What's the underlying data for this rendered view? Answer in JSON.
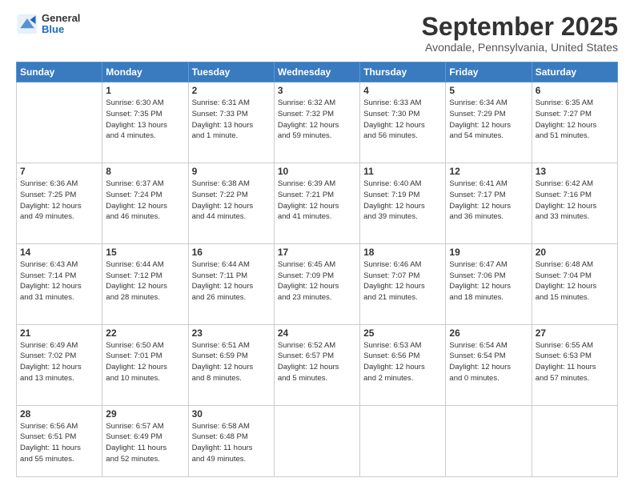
{
  "header": {
    "logo": {
      "line1": "General",
      "line2": "Blue"
    },
    "title": "September 2025",
    "location": "Avondale, Pennsylvania, United States"
  },
  "days_of_week": [
    "Sunday",
    "Monday",
    "Tuesday",
    "Wednesday",
    "Thursday",
    "Friday",
    "Saturday"
  ],
  "weeks": [
    [
      {
        "day": "",
        "info": ""
      },
      {
        "day": "1",
        "info": "Sunrise: 6:30 AM\nSunset: 7:35 PM\nDaylight: 13 hours\nand 4 minutes."
      },
      {
        "day": "2",
        "info": "Sunrise: 6:31 AM\nSunset: 7:33 PM\nDaylight: 13 hours\nand 1 minute."
      },
      {
        "day": "3",
        "info": "Sunrise: 6:32 AM\nSunset: 7:32 PM\nDaylight: 12 hours\nand 59 minutes."
      },
      {
        "day": "4",
        "info": "Sunrise: 6:33 AM\nSunset: 7:30 PM\nDaylight: 12 hours\nand 56 minutes."
      },
      {
        "day": "5",
        "info": "Sunrise: 6:34 AM\nSunset: 7:29 PM\nDaylight: 12 hours\nand 54 minutes."
      },
      {
        "day": "6",
        "info": "Sunrise: 6:35 AM\nSunset: 7:27 PM\nDaylight: 12 hours\nand 51 minutes."
      }
    ],
    [
      {
        "day": "7",
        "info": "Sunrise: 6:36 AM\nSunset: 7:25 PM\nDaylight: 12 hours\nand 49 minutes."
      },
      {
        "day": "8",
        "info": "Sunrise: 6:37 AM\nSunset: 7:24 PM\nDaylight: 12 hours\nand 46 minutes."
      },
      {
        "day": "9",
        "info": "Sunrise: 6:38 AM\nSunset: 7:22 PM\nDaylight: 12 hours\nand 44 minutes."
      },
      {
        "day": "10",
        "info": "Sunrise: 6:39 AM\nSunset: 7:21 PM\nDaylight: 12 hours\nand 41 minutes."
      },
      {
        "day": "11",
        "info": "Sunrise: 6:40 AM\nSunset: 7:19 PM\nDaylight: 12 hours\nand 39 minutes."
      },
      {
        "day": "12",
        "info": "Sunrise: 6:41 AM\nSunset: 7:17 PM\nDaylight: 12 hours\nand 36 minutes."
      },
      {
        "day": "13",
        "info": "Sunrise: 6:42 AM\nSunset: 7:16 PM\nDaylight: 12 hours\nand 33 minutes."
      }
    ],
    [
      {
        "day": "14",
        "info": "Sunrise: 6:43 AM\nSunset: 7:14 PM\nDaylight: 12 hours\nand 31 minutes."
      },
      {
        "day": "15",
        "info": "Sunrise: 6:44 AM\nSunset: 7:12 PM\nDaylight: 12 hours\nand 28 minutes."
      },
      {
        "day": "16",
        "info": "Sunrise: 6:44 AM\nSunset: 7:11 PM\nDaylight: 12 hours\nand 26 minutes."
      },
      {
        "day": "17",
        "info": "Sunrise: 6:45 AM\nSunset: 7:09 PM\nDaylight: 12 hours\nand 23 minutes."
      },
      {
        "day": "18",
        "info": "Sunrise: 6:46 AM\nSunset: 7:07 PM\nDaylight: 12 hours\nand 21 minutes."
      },
      {
        "day": "19",
        "info": "Sunrise: 6:47 AM\nSunset: 7:06 PM\nDaylight: 12 hours\nand 18 minutes."
      },
      {
        "day": "20",
        "info": "Sunrise: 6:48 AM\nSunset: 7:04 PM\nDaylight: 12 hours\nand 15 minutes."
      }
    ],
    [
      {
        "day": "21",
        "info": "Sunrise: 6:49 AM\nSunset: 7:02 PM\nDaylight: 12 hours\nand 13 minutes."
      },
      {
        "day": "22",
        "info": "Sunrise: 6:50 AM\nSunset: 7:01 PM\nDaylight: 12 hours\nand 10 minutes."
      },
      {
        "day": "23",
        "info": "Sunrise: 6:51 AM\nSunset: 6:59 PM\nDaylight: 12 hours\nand 8 minutes."
      },
      {
        "day": "24",
        "info": "Sunrise: 6:52 AM\nSunset: 6:57 PM\nDaylight: 12 hours\nand 5 minutes."
      },
      {
        "day": "25",
        "info": "Sunrise: 6:53 AM\nSunset: 6:56 PM\nDaylight: 12 hours\nand 2 minutes."
      },
      {
        "day": "26",
        "info": "Sunrise: 6:54 AM\nSunset: 6:54 PM\nDaylight: 12 hours\nand 0 minutes."
      },
      {
        "day": "27",
        "info": "Sunrise: 6:55 AM\nSunset: 6:53 PM\nDaylight: 11 hours\nand 57 minutes."
      }
    ],
    [
      {
        "day": "28",
        "info": "Sunrise: 6:56 AM\nSunset: 6:51 PM\nDaylight: 11 hours\nand 55 minutes."
      },
      {
        "day": "29",
        "info": "Sunrise: 6:57 AM\nSunset: 6:49 PM\nDaylight: 11 hours\nand 52 minutes."
      },
      {
        "day": "30",
        "info": "Sunrise: 6:58 AM\nSunset: 6:48 PM\nDaylight: 11 hours\nand 49 minutes."
      },
      {
        "day": "",
        "info": ""
      },
      {
        "day": "",
        "info": ""
      },
      {
        "day": "",
        "info": ""
      },
      {
        "day": "",
        "info": ""
      }
    ]
  ]
}
